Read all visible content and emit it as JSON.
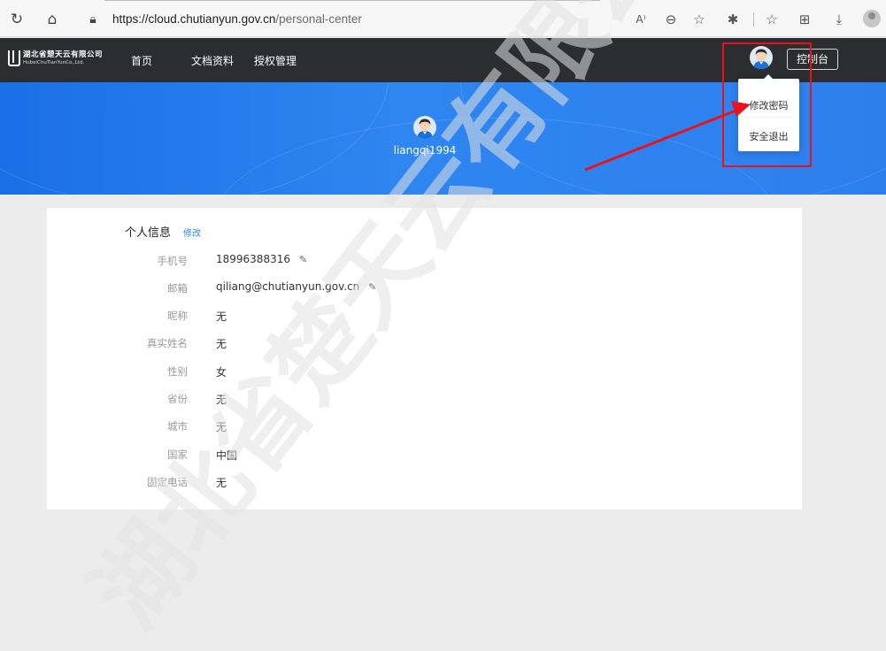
{
  "browser": {
    "url_host": "https://cloud.chutianyun.gov.cn",
    "url_path": "/personal-center"
  },
  "header": {
    "logo_cn": "湖北省楚天云有限公司",
    "logo_en": "HubeiChuTianYunCo.,Ltd.",
    "nav": [
      "首页",
      "文档资料",
      "授权管理"
    ],
    "console_label": "控制台"
  },
  "banner": {
    "username": "liangqi1994"
  },
  "dropdown": {
    "items": [
      "修改密码",
      "安全退出"
    ]
  },
  "profile": {
    "section_title": "个人信息",
    "edit_label": "修改",
    "fields": [
      {
        "label": "手机号",
        "value": "18996388316"
      },
      {
        "label": "邮箱",
        "value": "qiliang@chutianyun.gov.cn"
      },
      {
        "label": "昵称",
        "value": "无"
      },
      {
        "label": "真实姓名",
        "value": "无"
      },
      {
        "label": "性别",
        "value": "女"
      },
      {
        "label": "省份",
        "value": "无"
      },
      {
        "label": "城市",
        "value": "无"
      },
      {
        "label": "国家",
        "value": "中国"
      },
      {
        "label": "固定电话",
        "value": "无"
      }
    ]
  },
  "watermark": "湖北省楚天云有限公司",
  "colors": {
    "accent": "#2f86f0",
    "header_bg": "#2b2d31",
    "annotation_red": "#e8141c"
  }
}
